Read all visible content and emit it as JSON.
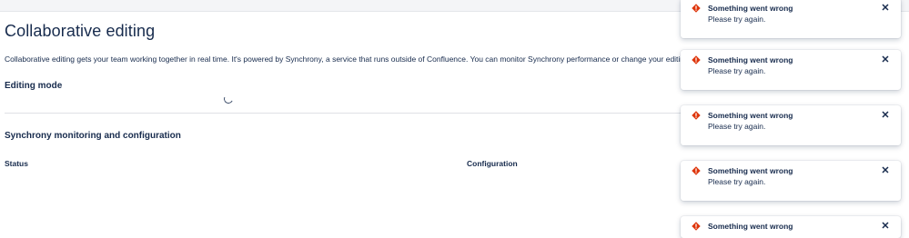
{
  "page": {
    "title": "Collaborative editing",
    "description": "Collaborative editing gets your team working together in real time. It's powered by Synchrony, a service that runs outside of Confluence. You can monitor Synchrony performance or change your editing",
    "editing_mode_heading": "Editing mode",
    "synchrony_heading": "Synchrony monitoring and configuration",
    "status_label": "Status",
    "configuration_label": "Configuration"
  },
  "flags": [
    {
      "title": "Something went wrong",
      "body": "Please try again.",
      "icon": "error-icon",
      "close_icon": "close-icon"
    },
    {
      "title": "Something went wrong",
      "body": "Please try again.",
      "icon": "error-icon",
      "close_icon": "close-icon"
    },
    {
      "title": "Something went wrong",
      "body": "Please try again.",
      "icon": "error-icon",
      "close_icon": "close-icon"
    },
    {
      "title": "Something went wrong",
      "body": "Please try again.",
      "icon": "error-icon",
      "close_icon": "close-icon"
    },
    {
      "title": "Something went wrong",
      "body": "",
      "icon": "error-icon",
      "close_icon": "close-icon"
    }
  ],
  "glyphs": {
    "close": "✕"
  },
  "colors": {
    "error": "#de350b",
    "text": "#172b4d"
  }
}
